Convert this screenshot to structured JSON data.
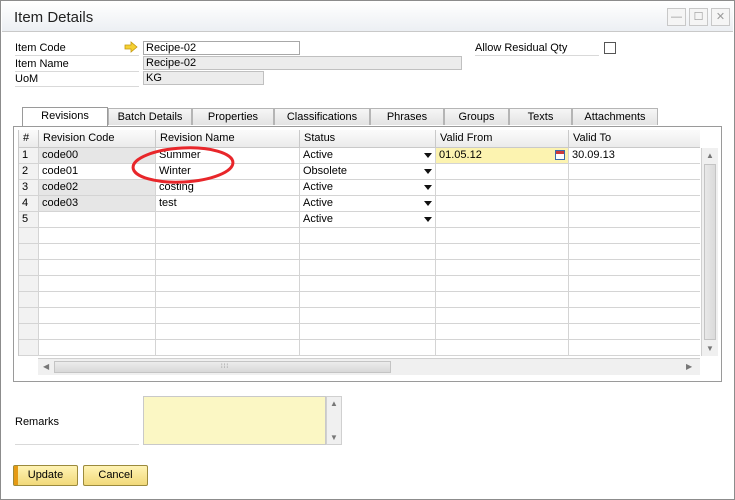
{
  "window": {
    "title": "Item Details"
  },
  "header": {
    "item_code_label": "Item Code",
    "item_code_value": "Recipe-02",
    "item_name_label": "Item Name",
    "item_name_value": "Recipe-02",
    "uom_label": "UoM",
    "uom_value": "KG",
    "allow_residual_label": "Allow Residual Qty",
    "allow_residual_checked": false
  },
  "tabs": [
    "Revisions",
    "Batch Details",
    "Properties",
    "Classifications",
    "Phrases",
    "Groups",
    "Texts",
    "Attachments"
  ],
  "active_tab": "Revisions",
  "grid": {
    "columns": [
      "#",
      "Revision Code",
      "Revision Name",
      "Status",
      "Valid From",
      "Valid To"
    ],
    "rows": [
      {
        "num": "1",
        "code": "code00",
        "name": "Summer",
        "status": "Active",
        "from": "01.05.12",
        "to": "30.09.13"
      },
      {
        "num": "2",
        "code": "code01",
        "name": "Winter",
        "status": "Obsolete",
        "from": "",
        "to": ""
      },
      {
        "num": "3",
        "code": "code02",
        "name": "costing",
        "status": "Active",
        "from": "",
        "to": ""
      },
      {
        "num": "4",
        "code": "code03",
        "name": "test",
        "status": "Active",
        "from": "",
        "to": ""
      },
      {
        "num": "5",
        "code": "",
        "name": "",
        "status": "Active",
        "from": "",
        "to": ""
      }
    ]
  },
  "remarks_label": "Remarks",
  "buttons": {
    "update": "Update",
    "cancel": "Cancel"
  },
  "colors": {
    "highlight_ellipse": "#e8262a",
    "button_yellow": "#f6e08a",
    "button_accent": "#e59a14",
    "remarks_bg": "#fbf7c4"
  }
}
